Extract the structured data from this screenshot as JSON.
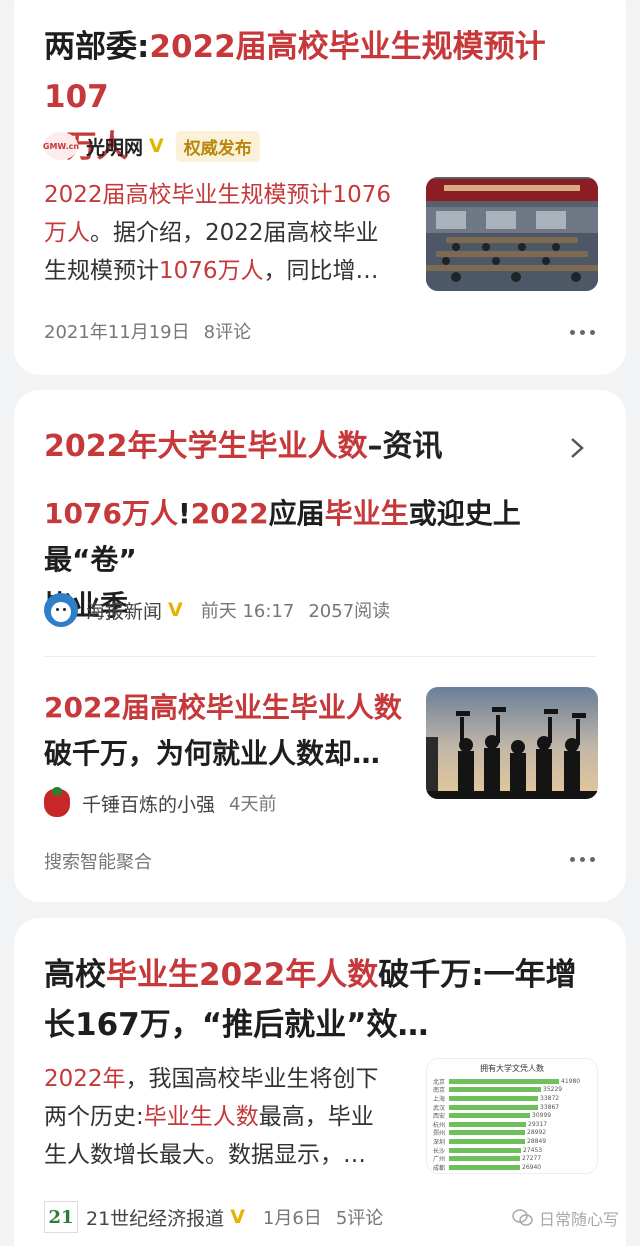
{
  "card1": {
    "title_plain": "两部委:",
    "title_hl_line1": "2022届高校毕业生规模预计107",
    "title_hl_line2": "6万人",
    "source_name": "光明网",
    "source_badge": "权威发布",
    "logo_text": "GMW.cn",
    "summary_hl1": "2022届高校毕业生规模预计1076",
    "summary_hl2": "万人",
    "summary_t1": "。据介绍，2022届高校毕业",
    "summary_t2": "生规模预计",
    "summary_hl3": "1076万人",
    "summary_t3": "，同比增…",
    "date": "2021年11月19日",
    "comments": "8评论"
  },
  "card2": {
    "header_hl": "2022年大学生毕业人数",
    "header_plain": "–资讯",
    "item1": {
      "hl1": "1076万人",
      "t1": "!",
      "hl2": "2022",
      "t2": "应届",
      "hl3": "毕业生",
      "t3": "或迎史上最“卷”",
      "line2": "毕业季",
      "source": "海报新闻",
      "time": "前天 16:17",
      "reads": "2057阅读"
    },
    "item2": {
      "hl1": "2022届高校毕业生毕业人数",
      "line2": "破千万，为何就业人数却…",
      "source": "千锤百炼的小强",
      "time": "4天前"
    },
    "footer": "搜索智能聚合"
  },
  "card3": {
    "title_plain1": "高校",
    "title_hl1": "毕业生2022年人数",
    "title_plain2": "破千万:一年增",
    "title_line2": "长167万，“推后就业”效…",
    "body_hl1": "2022年",
    "body_t1": "，我国高校毕业生将创下",
    "body_t2": "两个历史:",
    "body_hl2": "毕业生人数",
    "body_t3": "最高，毕业",
    "body_line3": "生人数增长最大。数据显示，…",
    "source": "21世纪经济报道",
    "source_logo": "21",
    "date": "1月6日",
    "comments": "5评论",
    "chart_title": "拥有大学文凭人数",
    "chart_rows": [
      {
        "city": "北京",
        "value": 41980
      },
      {
        "city": "南京",
        "value": 35229
      },
      {
        "city": "上海",
        "value": 33872
      },
      {
        "city": "武汉",
        "value": 33867
      },
      {
        "city": "西安",
        "value": 30999
      },
      {
        "city": "杭州",
        "value": 29317
      },
      {
        "city": "郑州",
        "value": 28992
      },
      {
        "city": "深圳",
        "value": 28849
      },
      {
        "city": "长沙",
        "value": 27453
      },
      {
        "city": "广州",
        "value": 27277
      },
      {
        "city": "成都",
        "value": 26940
      }
    ]
  },
  "watermark": "日常随心写",
  "colors": {
    "accent": "#c6383a",
    "badge_bg": "#fbf1d8",
    "badge_text": "#b8860b"
  }
}
